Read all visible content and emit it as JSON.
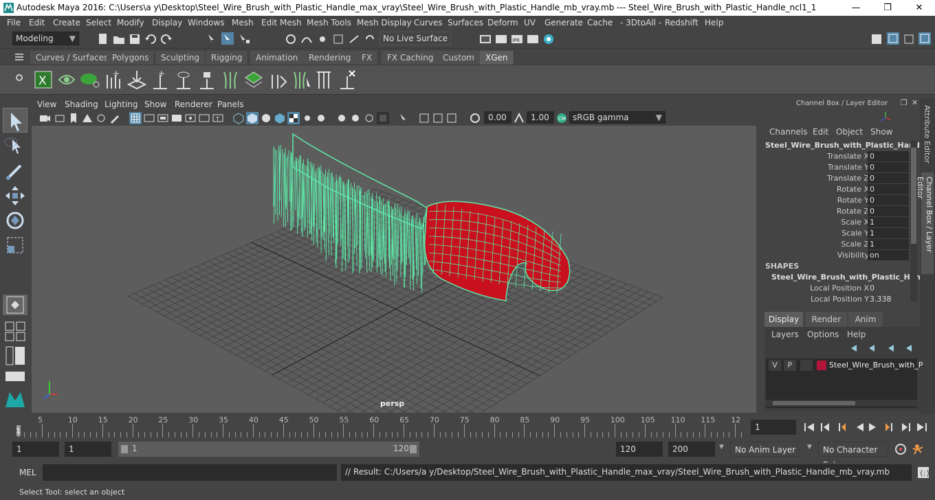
{
  "window": {
    "title": "Autodesk Maya 2016: C:\\Users\\a y\\Desktop\\Steel_Wire_Brush_with_Plastic_Handle_max_vray\\Steel_Wire_Brush_with_Plastic_Handle_mb_vray.mb   ---   Steel_Wire_Brush_with_Plastic_Handle_ncl1_1",
    "minimize": "—",
    "maximize": "❐",
    "close": "✕"
  },
  "menus": [
    "File",
    "Edit",
    "Create",
    "Select",
    "Modify",
    "Display",
    "Windows",
    "Mesh",
    "Edit Mesh",
    "Mesh Tools",
    "Mesh Display",
    "Curves",
    "Surfaces",
    "Deform",
    "UV",
    "Generate",
    "Cache",
    "- 3DtoAll -",
    "Redshift",
    "Help"
  ],
  "statusline": {
    "mode": "Modeling",
    "live_surface": "No Live Surface"
  },
  "shelf_tabs": [
    "Curves / Surfaces",
    "Polygons",
    "Sculpting",
    "Rigging",
    "Animation",
    "Rendering",
    "FX",
    "FX Caching",
    "Custom",
    "XGen"
  ],
  "shelf_active": "XGen",
  "viewport": {
    "menus": [
      "View",
      "Shading",
      "Lighting",
      "Show",
      "Renderer",
      "Panels"
    ],
    "exposure": "0.00",
    "gamma": "1.00",
    "colorspace": "sRGB gamma",
    "camera_label": "persp"
  },
  "channel_box": {
    "title": "Channel Box / Layer Editor",
    "menus": [
      "Channels",
      "Edit",
      "Object",
      "Show"
    ],
    "object_name": "Steel_Wire_Brush_with_Plastic_Handle...",
    "attributes": [
      {
        "name": "Translate X",
        "value": "0"
      },
      {
        "name": "Translate Y",
        "value": "0"
      },
      {
        "name": "Translate Z",
        "value": "0"
      },
      {
        "name": "Rotate X",
        "value": "0"
      },
      {
        "name": "Rotate Y",
        "value": "0"
      },
      {
        "name": "Rotate Z",
        "value": "0"
      },
      {
        "name": "Scale X",
        "value": "1"
      },
      {
        "name": "Scale Y",
        "value": "1"
      },
      {
        "name": "Scale Z",
        "value": "1"
      },
      {
        "name": "Visibility",
        "value": "on"
      }
    ],
    "shapes_header": "SHAPES",
    "shape_name": "Steel_Wire_Brush_with_Plastic_Hand...",
    "shape_attributes": [
      {
        "name": "Local Position X",
        "value": "0"
      },
      {
        "name": "Local Position Y",
        "value": "3.338"
      }
    ]
  },
  "side_tabs": [
    "Attribute Editor",
    "Channel Box / Layer Editor"
  ],
  "layer_editor": {
    "tabs": [
      "Display",
      "Render",
      "Anim"
    ],
    "active_tab": "Display",
    "menus": [
      "Layers",
      "Options",
      "Help"
    ],
    "layer": {
      "v": "V",
      "p": "P",
      "name": "Steel_Wire_Brush_with_P",
      "color": "#b0163a"
    }
  },
  "timeline": {
    "labels": [
      "5",
      "10",
      "15",
      "20",
      "25",
      "30",
      "35",
      "40",
      "45",
      "50",
      "55",
      "60",
      "65",
      "70",
      "75",
      "80",
      "85",
      "90",
      "95",
      "100",
      "105",
      "110",
      "115",
      "12"
    ],
    "current_frame": "1",
    "current_frame_field": "1"
  },
  "range": {
    "start": "1",
    "playback_start": "1",
    "range_start": "1",
    "range_end": "120",
    "playback_end": "120",
    "end": "200",
    "anim_layer": "No Anim Layer",
    "character_set": "No Character Set"
  },
  "command": {
    "language": "MEL",
    "result": "// Result: C:/Users/a y/Desktop/Steel_Wire_Brush_with_Plastic_Handle_max_vray/Steel_Wire_Brush_with_Plastic_Handle_mb_vray.mb"
  },
  "help_line": "Select Tool: select an object",
  "colors": {
    "wire": "#5fe8a8",
    "handle": "#c8101e",
    "accent": "#5285a6"
  }
}
